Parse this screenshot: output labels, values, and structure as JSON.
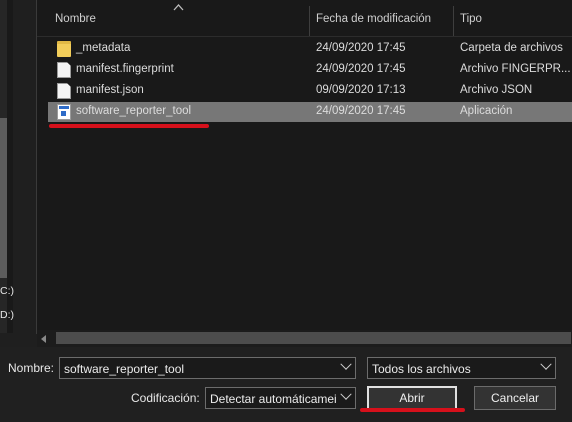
{
  "header": {
    "col_name": "Nombre",
    "col_date": "Fecha de modificación",
    "col_type": "Tipo"
  },
  "nav": {
    "drives": [
      "C:)",
      "D:)"
    ]
  },
  "files": [
    {
      "name": "_metadata",
      "date": "24/09/2020 17:45",
      "type": "Carpeta de archivos",
      "icon": "folder-icon",
      "selected": false
    },
    {
      "name": "manifest.fingerprint",
      "date": "24/09/2020 17:45",
      "type": "Archivo FINGERPR...",
      "icon": "file-icon",
      "selected": false
    },
    {
      "name": "manifest.json",
      "date": "09/09/2020 17:13",
      "type": "Archivo JSON",
      "icon": "file-icon",
      "selected": false
    },
    {
      "name": "software_reporter_tool",
      "date": "24/09/2020 17:45",
      "type": "Aplicación",
      "icon": "application-icon",
      "selected": true
    }
  ],
  "footer": {
    "name_label": "Nombre:",
    "name_value": "software_reporter_tool",
    "filter_value": "Todos los archivos",
    "encoding_label": "Codificación:",
    "encoding_value": "Detectar automáticamei",
    "open_label": "Abrir",
    "cancel_label": "Cancelar"
  },
  "colors": {
    "background": "#1f1f1f",
    "selection": "#777777",
    "annotation_red": "#d6101b"
  }
}
